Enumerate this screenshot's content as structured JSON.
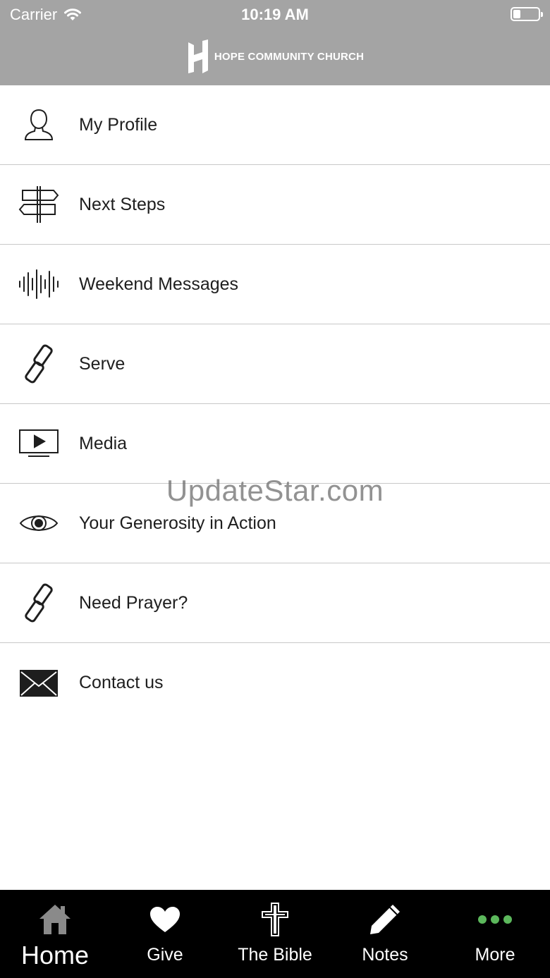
{
  "status_bar": {
    "carrier": "Carrier",
    "time": "10:19 AM"
  },
  "header": {
    "brand_name": "HOPE COMMUNITY CHURCH",
    "background": "#a4a4a4"
  },
  "menu": {
    "items": [
      {
        "label": "My Profile",
        "icon": "user-icon"
      },
      {
        "label": "Next Steps",
        "icon": "signpost-icon"
      },
      {
        "label": "Weekend Messages",
        "icon": "audio-wave-icon"
      },
      {
        "label": "Serve",
        "icon": "link-icon"
      },
      {
        "label": "Media",
        "icon": "play-screen-icon"
      },
      {
        "label": "Your Generosity in Action",
        "icon": "eye-icon"
      },
      {
        "label": "Need Prayer?",
        "icon": "link-icon"
      },
      {
        "label": "Contact us",
        "icon": "envelope-icon"
      }
    ]
  },
  "watermark": "UpdateStar.com",
  "tabbar": {
    "active_color": "#ffffff",
    "more_color": "#5cb85c",
    "tabs": [
      {
        "label": "Home",
        "icon": "home-icon",
        "active": true
      },
      {
        "label": "Give",
        "icon": "heart-icon"
      },
      {
        "label": "The Bible",
        "icon": "cross-icon"
      },
      {
        "label": "Notes",
        "icon": "pencil-icon"
      },
      {
        "label": "More",
        "icon": "more-dots-icon"
      }
    ]
  }
}
